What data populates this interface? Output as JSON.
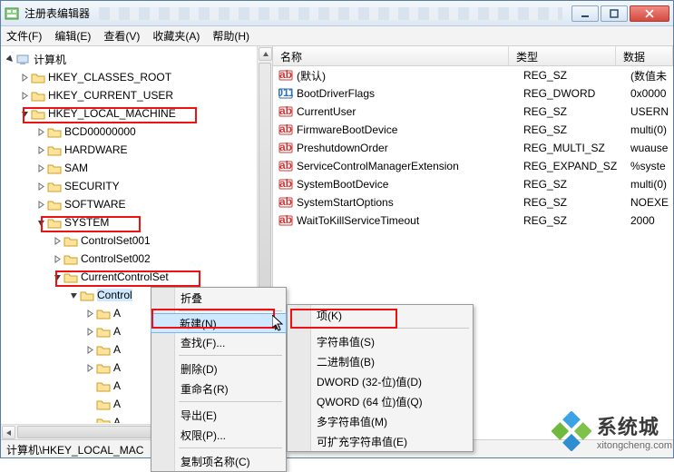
{
  "window": {
    "title": "注册表编辑器"
  },
  "menus": [
    "文件(F)",
    "编辑(E)",
    "查看(V)",
    "收藏夹(A)",
    "帮助(H)"
  ],
  "tree": {
    "root": "计算机",
    "hk": [
      "HKEY_CLASSES_ROOT",
      "HKEY_CURRENT_USER",
      "HKEY_LOCAL_MACHINE"
    ],
    "hklm": [
      "BCD00000000",
      "HARDWARE",
      "SAM",
      "SECURITY",
      "SOFTWARE",
      "SYSTEM"
    ],
    "system": [
      "ControlSet001",
      "ControlSet002",
      "CurrentControlSet"
    ],
    "ccs": "Control",
    "ccs_children": [
      "A",
      "A",
      "A",
      "A",
      "A",
      "A",
      "A"
    ]
  },
  "table": {
    "headers": [
      "名称",
      "类型",
      "数据"
    ],
    "rows": [
      {
        "icon": "str",
        "name": "(默认)",
        "type": "REG_SZ",
        "data": "(数值未"
      },
      {
        "icon": "num",
        "name": "BootDriverFlags",
        "type": "REG_DWORD",
        "data": "0x0000"
      },
      {
        "icon": "str",
        "name": "CurrentUser",
        "type": "REG_SZ",
        "data": "USERN"
      },
      {
        "icon": "str",
        "name": "FirmwareBootDevice",
        "type": "REG_SZ",
        "data": "multi(0)"
      },
      {
        "icon": "str",
        "name": "PreshutdownOrder",
        "type": "REG_MULTI_SZ",
        "data": "wuause"
      },
      {
        "icon": "str",
        "name": "ServiceControlManagerExtension",
        "type": "REG_EXPAND_SZ",
        "data": "%syste"
      },
      {
        "icon": "str",
        "name": "SystemBootDevice",
        "type": "REG_SZ",
        "data": "multi(0)"
      },
      {
        "icon": "str",
        "name": "SystemStartOptions",
        "type": "REG_SZ",
        "data": " NOEXE"
      },
      {
        "icon": "str",
        "name": "WaitToKillServiceTimeout",
        "type": "REG_SZ",
        "data": "2000"
      }
    ]
  },
  "ctx1": {
    "collapse": "折叠",
    "new": "新建(N)",
    "find": "查找(F)...",
    "delete": "删除(D)",
    "rename": "重命名(R)",
    "export": "导出(E)",
    "perm": "权限(P)...",
    "copyname": "复制项名称(C)"
  },
  "ctx2": {
    "key": "项(K)",
    "string": "字符串值(S)",
    "binary": "二进制值(B)",
    "dword": "DWORD (32-位)值(D)",
    "qword": "QWORD (64 位)值(Q)",
    "multi": "多字符串值(M)",
    "expand": "可扩充字符串值(E)"
  },
  "status": "计算机\\HKEY_LOCAL_MAC",
  "watermark": {
    "brand": "系统城",
    "url": "xitongcheng.com"
  }
}
